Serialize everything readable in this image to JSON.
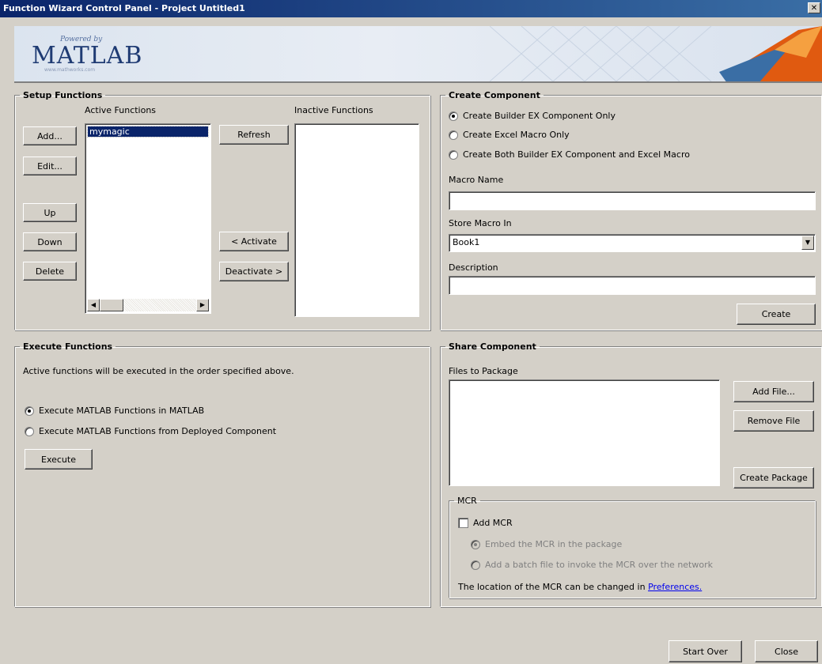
{
  "window": {
    "title": "Function Wizard Control Panel - Project Untitled1"
  },
  "banner": {
    "powered_by": "Powered by",
    "logo": "MATLAB",
    "site": "www.mathworks.com"
  },
  "setup": {
    "legend": "Setup Functions",
    "active_label": "Active Functions",
    "inactive_label": "Inactive Functions",
    "active_items": [
      "mymagic"
    ],
    "buttons": {
      "add": "Add...",
      "edit": "Edit...",
      "up": "Up",
      "down": "Down",
      "delete": "Delete",
      "refresh": "Refresh",
      "activate": "< Activate",
      "deactivate": "Deactivate >"
    }
  },
  "create": {
    "legend": "Create Component",
    "options": [
      "Create Builder EX Component Only",
      "Create Excel Macro Only",
      "Create Both Builder EX Component and Excel Macro"
    ],
    "selected_option": 0,
    "macro_name_label": "Macro Name",
    "macro_name_value": "",
    "store_label": "Store Macro In",
    "store_value": "Book1",
    "description_label": "Description",
    "description_value": "",
    "create_button": "Create"
  },
  "execute": {
    "legend": "Execute Functions",
    "note": "Active functions will be executed in the order specified above.",
    "options": [
      "Execute MATLAB Functions in MATLAB",
      "Execute MATLAB Functions from Deployed Component"
    ],
    "selected_option": 0,
    "execute_button": "Execute"
  },
  "share": {
    "legend": "Share Component",
    "files_label": "Files to Package",
    "add_file": "Add File...",
    "remove_file": "Remove File",
    "create_package": "Create Package",
    "mcr": {
      "legend": "MCR",
      "add_mcr": "Add MCR",
      "embed": "Embed the MCR in the package",
      "batch": "Add a batch file to invoke the MCR over the network",
      "location_text": "The location of the MCR can be changed in",
      "preferences_link": "Preferences."
    }
  },
  "footer": {
    "start_over": "Start Over",
    "close": "Close"
  }
}
